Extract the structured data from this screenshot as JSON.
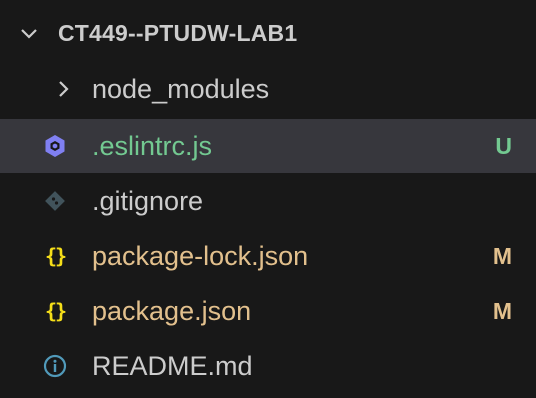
{
  "explorer": {
    "folder_name": "CT449--PTUDW-LAB1",
    "folder_expanded": true,
    "items": [
      {
        "label": "node_modules",
        "type": "folder",
        "icon": "chevron-right-icon",
        "status": "",
        "status_color": ""
      },
      {
        "label": ".eslintrc.js",
        "type": "file",
        "icon": "eslint-icon",
        "status": "U",
        "status_color": "#73c991"
      },
      {
        "label": ".gitignore",
        "type": "file",
        "icon": "git-icon",
        "status": "",
        "status_color": ""
      },
      {
        "label": "package-lock.json",
        "type": "file",
        "icon": "json-braces-icon",
        "status": "M",
        "status_color": "#e2c08d"
      },
      {
        "label": "package.json",
        "type": "file",
        "icon": "json-braces-icon",
        "status": "M",
        "status_color": "#e2c08d"
      },
      {
        "label": "README.md",
        "type": "file",
        "icon": "info-icon",
        "status": "",
        "status_color": ""
      }
    ]
  },
  "colors": {
    "background": "#181818",
    "selected_row": "#37373d",
    "text": "#cccccc",
    "untracked": "#73c991",
    "modified": "#e2c08d",
    "eslint": "#8080f2",
    "json": "#f5de19",
    "info": "#519aba"
  }
}
